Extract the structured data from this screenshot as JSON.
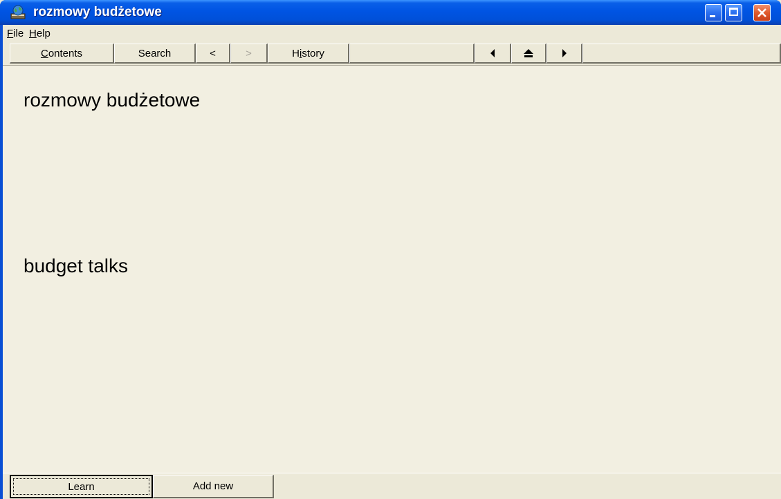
{
  "window": {
    "title": "rozmowy budżetowe",
    "icon": "globe-book-icon",
    "controls": {
      "minimize": "minimize-icon",
      "maximize": "maximize-icon",
      "close": "close-icon"
    }
  },
  "menu": {
    "file": {
      "first": "F",
      "rest": "ile"
    },
    "help": {
      "first": "H",
      "rest": "elp"
    }
  },
  "toolbar": {
    "contents": {
      "first": "C",
      "rest": "ontents"
    },
    "search": "Search",
    "back": "<",
    "forward": ">",
    "history": {
      "before": "H",
      "underline": "i",
      "after": "story"
    },
    "prev_icon": "triangle-left-icon",
    "top_icon": "eject-up-icon",
    "next_icon": "triangle-right-icon"
  },
  "content": {
    "term": "rozmowy budżetowe",
    "translation": "budget talks"
  },
  "buttons": {
    "learn": "Learn",
    "add_new": "Add new"
  },
  "colors": {
    "titlebar": "#0054e3",
    "face": "#ece9d8",
    "content_bg": "#f2efe1",
    "close_button": "#e05a2c"
  }
}
